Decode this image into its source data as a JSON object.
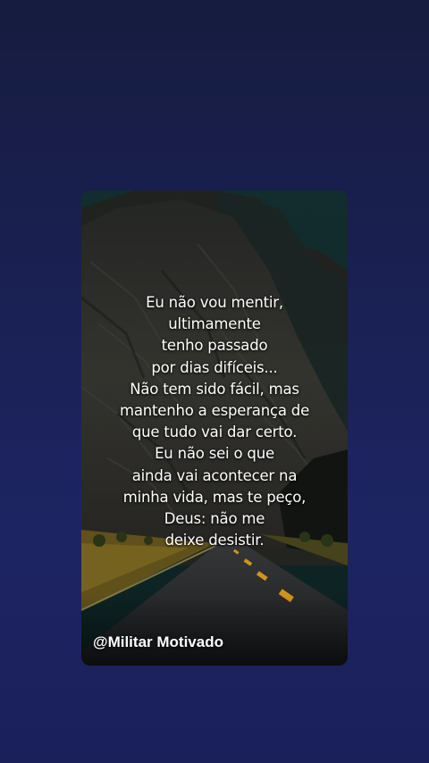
{
  "background": {
    "top_color": "#161c3f",
    "bottom_color": "#1d2462"
  },
  "post": {
    "image_description_icon": "mountain-road-image",
    "quote_lines": [
      "Eu não vou mentir,",
      "ultimamente",
      " tenho passado",
      "por dias difíceis...",
      "Não tem sido fácil, mas",
      " mantenho a esperança de",
      "que tudo vai dar certo.",
      "Eu não sei o que",
      "ainda vai acontecer na",
      "minha vida, mas te peço,",
      "Deus: não me",
      "deixe desistir."
    ],
    "handle": "@Militar Motivado"
  }
}
